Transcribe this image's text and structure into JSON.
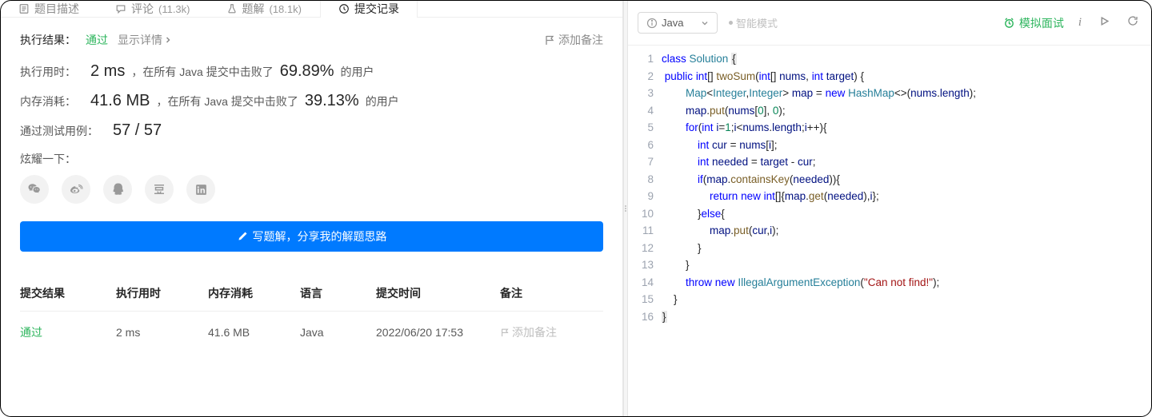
{
  "tabs": {
    "desc": "题目描述",
    "comments": "评论",
    "comments_count": "(11.3k)",
    "solutions": "题解",
    "solutions_count": "(18.1k)",
    "submissions": "提交记录"
  },
  "result": {
    "label": "执行结果：",
    "status": "通过",
    "show_detail": "显示详情",
    "add_note": "添加备注"
  },
  "stats": {
    "time_label": "执行用时：",
    "time_value": "2 ms",
    "time_text1": "，在所有 Java 提交中击败了",
    "time_pct": "69.89%",
    "time_text2": "的用户",
    "mem_label": "内存消耗：",
    "mem_value": "41.6 MB",
    "mem_text1": "，在所有 Java 提交中击败了",
    "mem_pct": "39.13%",
    "mem_text2": "的用户",
    "tests_label": "通过测试用例：",
    "tests_value": "57 / 57"
  },
  "share": {
    "label": "炫耀一下：",
    "write_solution": "写题解，分享我的解题思路"
  },
  "table": {
    "headers": [
      "提交结果",
      "执行用时",
      "内存消耗",
      "语言",
      "提交时间",
      "备注"
    ],
    "row": {
      "status": "通过",
      "time": "2 ms",
      "memory": "41.6 MB",
      "lang": "Java",
      "date": "2022/06/20 17:53",
      "note": "添加备注"
    }
  },
  "editor": {
    "language": "Java",
    "smart_mode": "智能模式",
    "mock_interview": "模拟面试",
    "lines": [
      "1",
      "2",
      "3",
      "4",
      "5",
      "6",
      "7",
      "8",
      "9",
      "10",
      "11",
      "12",
      "13",
      "14",
      "15",
      "16"
    ]
  }
}
